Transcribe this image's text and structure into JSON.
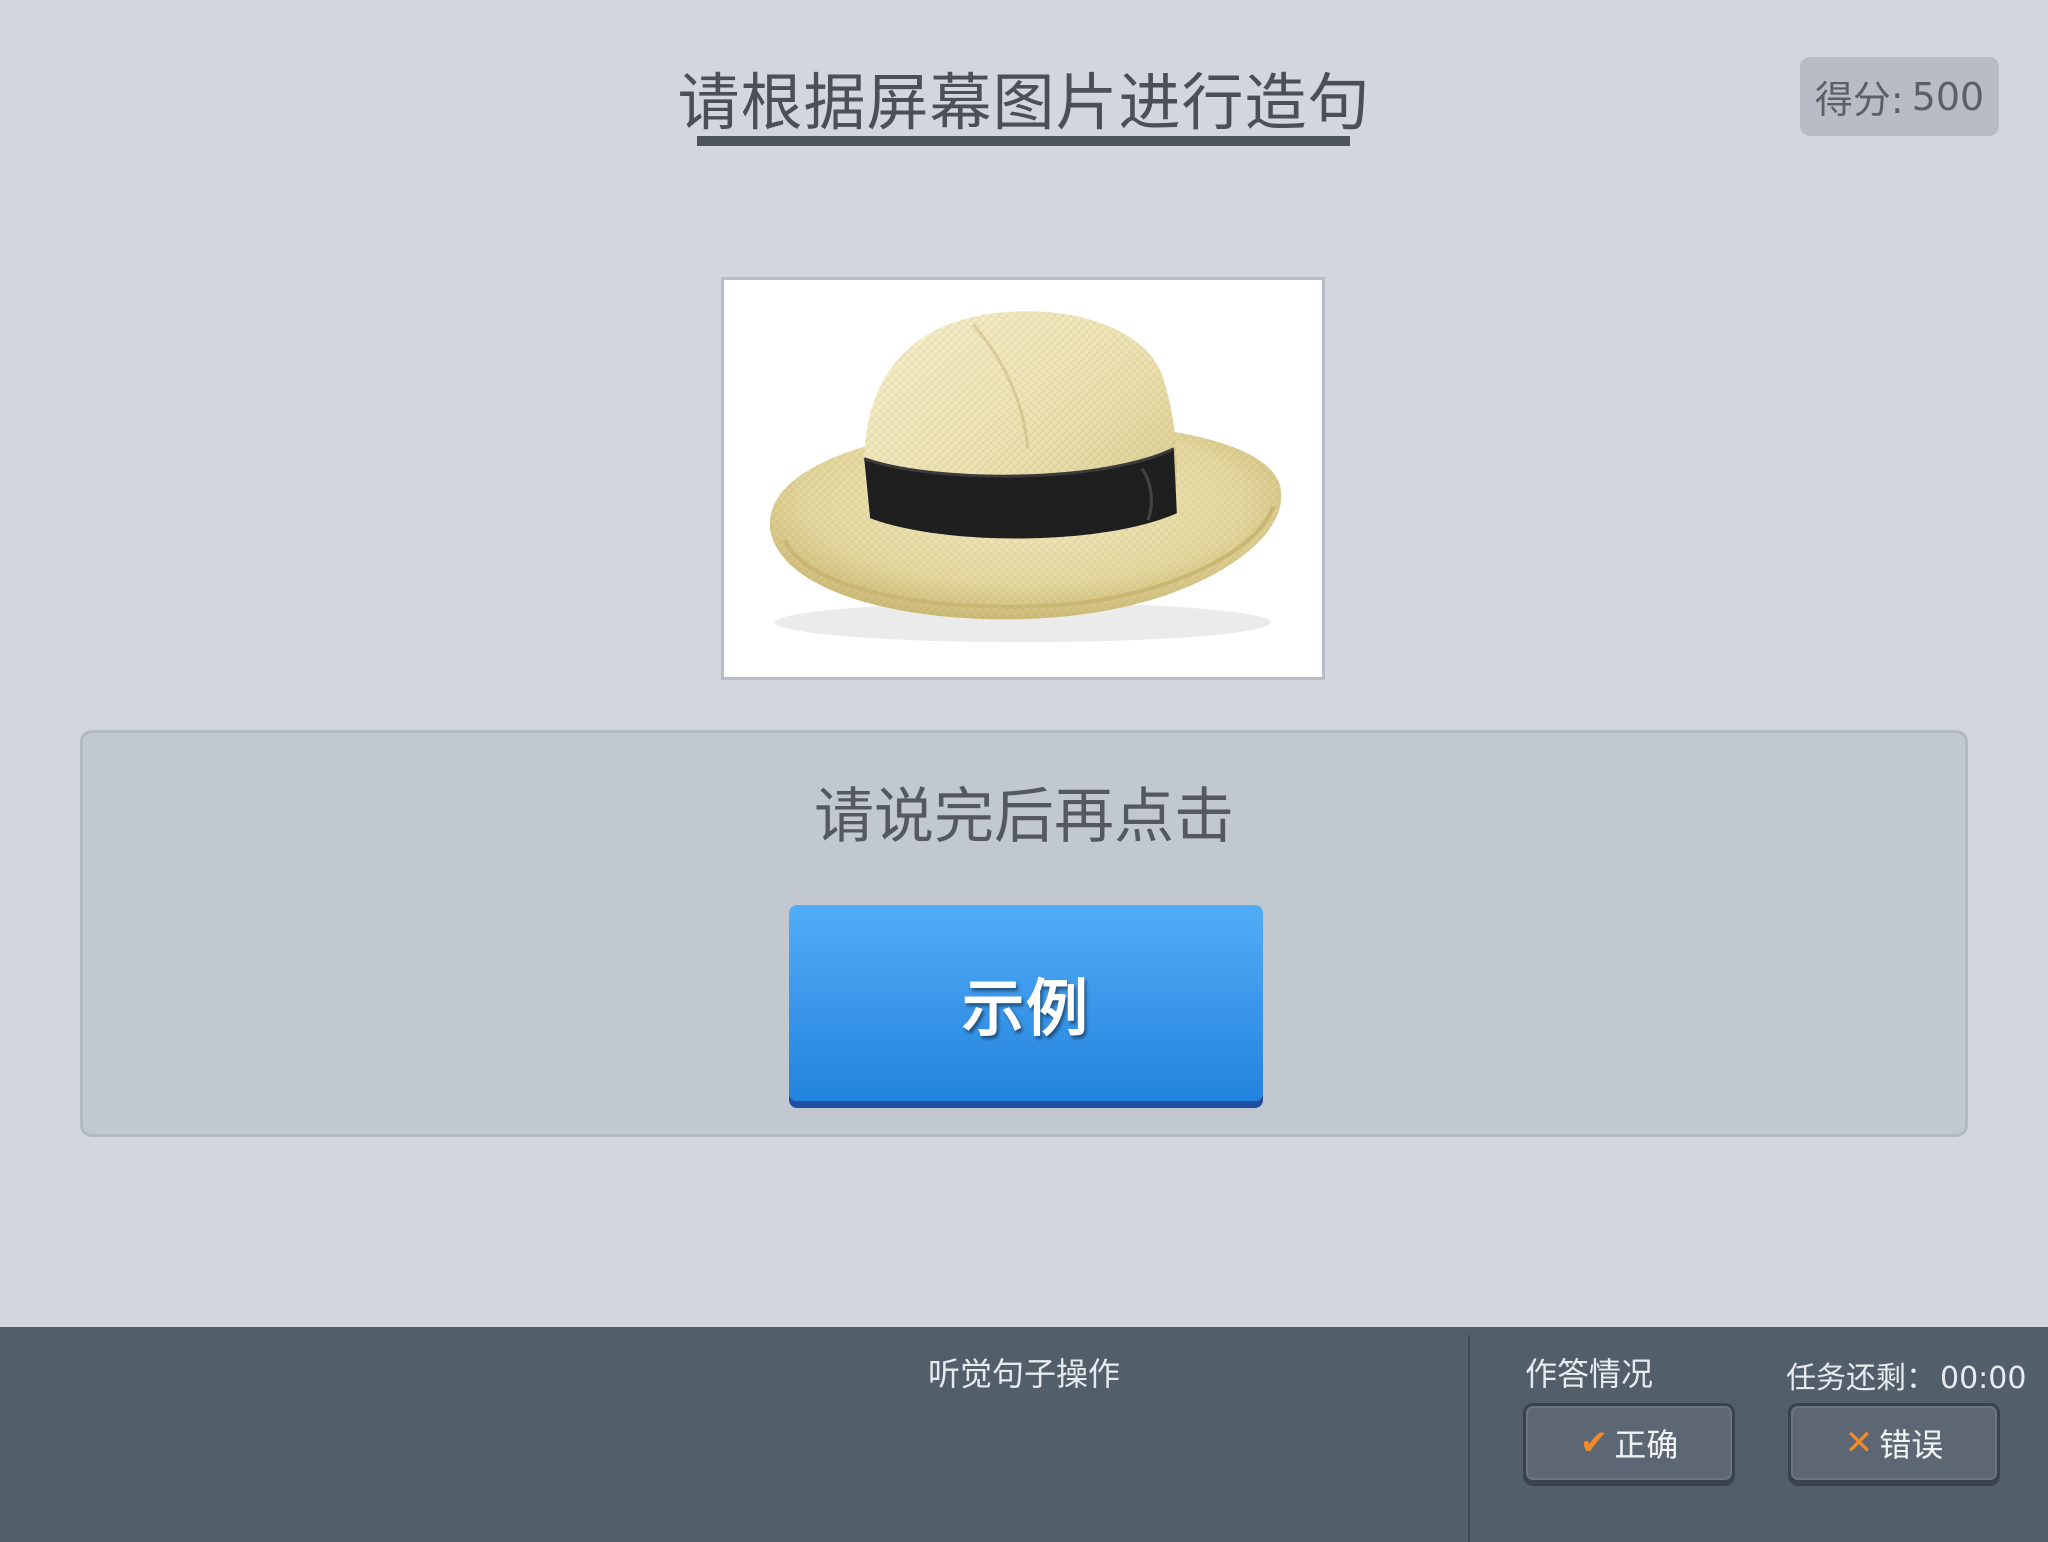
{
  "header": {
    "title": "请根据屏幕图片进行造句",
    "score_label": "得分:",
    "score_value": "500"
  },
  "picture": {
    "subject": "hat-image"
  },
  "panel": {
    "instruction": "请说完后再点击",
    "example_button": "示例"
  },
  "footer": {
    "center_label": "听觉句子操作",
    "answer_status_label": "作答情况",
    "timer_label": "任务还剩：",
    "timer_value": "00:00",
    "correct_button": "正确",
    "wrong_button": "错误",
    "correct_icon": "checkmark-icon",
    "wrong_icon": "x-icon"
  },
  "colors": {
    "background": "#d1d6df",
    "bottom_bar": "#525e6a",
    "example_button": "#3b97ea",
    "icon_accent": "#ef8a2a"
  }
}
